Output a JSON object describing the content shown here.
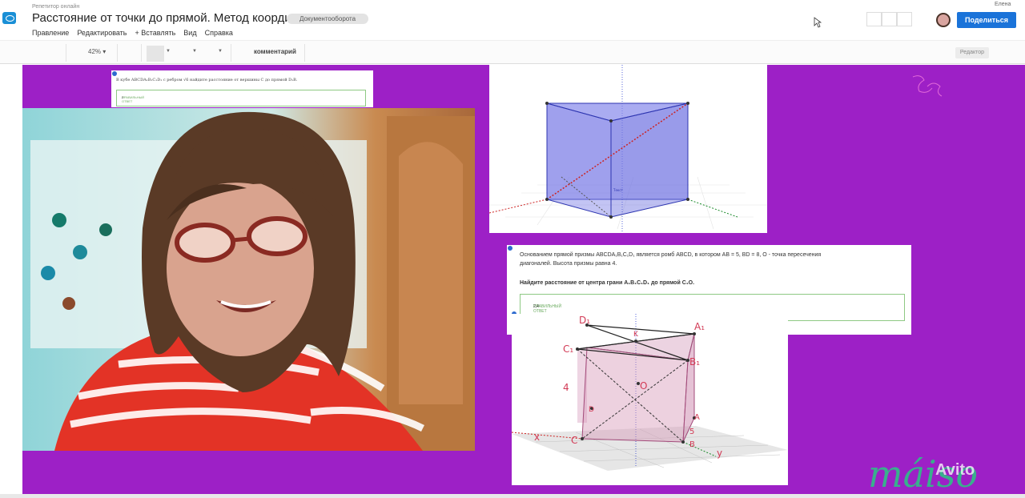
{
  "app": {
    "supertitle": "Репетитор онлайн",
    "title": "Расстояние от точки до прямой. Метод координат",
    "tag": "Документооборота",
    "username": "Елена",
    "share_label": "Поделиться"
  },
  "menu": [
    "Правление",
    "Редактировать",
    "+ Вставлять",
    "Вид",
    "Справка"
  ],
  "toolbar": {
    "zoom": "42%",
    "comment_label": "комментарий",
    "mode_label": "Редактор"
  },
  "top_panel": {
    "question": "В кубе ABCDA₁B₁C₁D₁ с ребром √6 найдите расстояние от вершины C до прямой D₁B.",
    "answer_label": "ПРАВИЛЬНЫЙ ОТВЕТ",
    "answer_value": "2"
  },
  "problem": {
    "line1": "Основанием прямой призмы ABCDA₁B₁C₁D₁ является ромб ABCD, в котором AB = 5, BD = 8, O - точка пересечения",
    "line2": "диагоналей. Высота призмы равна 4.",
    "question": "Найдите расстояние от центра грани A₁B₁C₁D₁ до прямой C₁O.",
    "answer_label": "ПРАВИЛЬНЫЙ ОТВЕТ",
    "answer_value": "2,4"
  },
  "geo1": {
    "caption": "Текст"
  },
  "geo2": {
    "labels": [
      "D₁",
      "K",
      "A₁",
      "C₁",
      "B₁",
      "4",
      "O",
      "A",
      "5",
      "C",
      "B",
      "y",
      "x",
      "D"
    ]
  },
  "watermark": {
    "brand": "Avito",
    "script": "máiso"
  },
  "colors": {
    "canvas": "#9d20c6",
    "share": "#1a73d9",
    "answer_border": "#8ec983"
  }
}
